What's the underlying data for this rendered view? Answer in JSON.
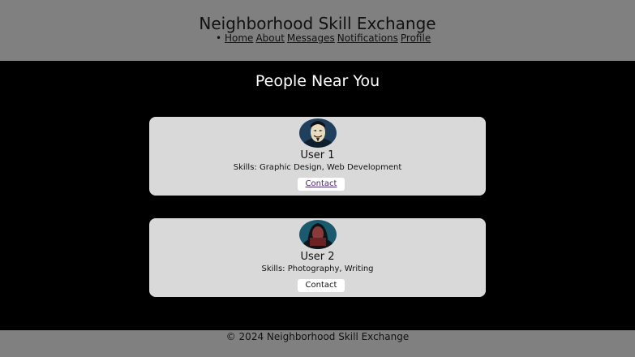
{
  "header": {
    "title": "Neighborhood Skill Exchange",
    "nav": {
      "bullet": "•",
      "items": [
        "Home",
        "About",
        "Messages",
        "Notifications",
        "Profile"
      ]
    }
  },
  "main": {
    "title": "People Near You",
    "users": [
      {
        "name": "User 1",
        "skills": "Skills: Graphic Design, Web Development",
        "contact_label": "Contact",
        "avatar_icon": "masked-person-avatar"
      },
      {
        "name": "User 2",
        "skills": "Skills: Photography, Writing",
        "contact_label": "Contact",
        "avatar_icon": "hooded-person-avatar"
      }
    ]
  },
  "footer": {
    "text": "© 2024 Neighborhood Skill Exchange"
  },
  "colors": {
    "header_bg": "#808080",
    "main_bg": "#000000",
    "card_bg": "#d9d9d9",
    "visited_link": "#4a2a6a"
  }
}
